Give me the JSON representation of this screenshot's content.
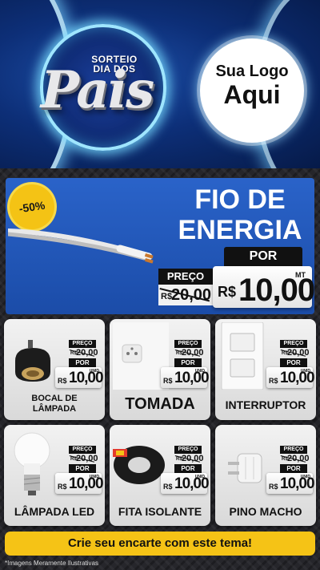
{
  "header": {
    "badge_top": "SORTEIO DIA DOS",
    "badge_big": "Pais",
    "logo_line1": "Sua Logo",
    "logo_line2": "Aqui"
  },
  "hero": {
    "discount": "-50%",
    "title_line1": "FIO DE",
    "title_line2": "ENERGIA",
    "por_label": "POR",
    "preco_label": "PREÇO",
    "old_currency": "R$",
    "old_price": "20,00",
    "unit": "MT",
    "new_currency": "R$",
    "new_price": "10,00"
  },
  "products": [
    {
      "name_line1": "BOCAL DE",
      "name_line2": "LÂMPADA",
      "preco_label": "PREÇO",
      "old_currency": "R$",
      "old_price": "20,00",
      "por_label": "POR",
      "unit": "UNID",
      "new_currency": "R$",
      "new_price": "10,00",
      "icon": "lamp-socket-icon"
    },
    {
      "name_line1": "TOMADA",
      "name_line2": "",
      "preco_label": "PREÇO",
      "old_currency": "R$",
      "old_price": "20,00",
      "por_label": "POR",
      "unit": "UNID",
      "new_currency": "R$",
      "new_price": "10,00",
      "icon": "outlet-icon"
    },
    {
      "name_line1": "INTERRUPTOR",
      "name_line2": "",
      "preco_label": "PREÇO",
      "old_currency": "R$",
      "old_price": "20,00",
      "por_label": "POR",
      "unit": "UNID",
      "new_currency": "R$",
      "new_price": "10,00",
      "icon": "light-switch-icon"
    },
    {
      "name_line1": "LÂMPADA LED",
      "name_line2": "",
      "preco_label": "PREÇO",
      "old_currency": "R$",
      "old_price": "20,00",
      "por_label": "POR",
      "unit": "UNID",
      "new_currency": "R$",
      "new_price": "10,00",
      "icon": "led-bulb-icon"
    },
    {
      "name_line1": "FITA ISOLANTE",
      "name_line2": "",
      "preco_label": "PREÇO",
      "old_currency": "R$",
      "old_price": "20,00",
      "por_label": "POR",
      "unit": "UNID",
      "new_currency": "R$",
      "new_price": "10,00",
      "icon": "insulating-tape-icon"
    },
    {
      "name_line1": "PINO MACHO",
      "name_line2": "",
      "preco_label": "PREÇO",
      "old_currency": "R$",
      "old_price": "20,00",
      "por_label": "POR",
      "unit": "UNID",
      "new_currency": "R$",
      "new_price": "10,00",
      "icon": "plug-icon"
    }
  ],
  "cta": {
    "label": "Crie seu encarte com este tema!"
  },
  "footer": {
    "disclaimer": "*Imagens Meramente Ilustrativas"
  },
  "colors": {
    "accent_yellow": "#f5c316",
    "hero_blue": "#1b4ca8",
    "header_blue": "#0d2f78"
  }
}
